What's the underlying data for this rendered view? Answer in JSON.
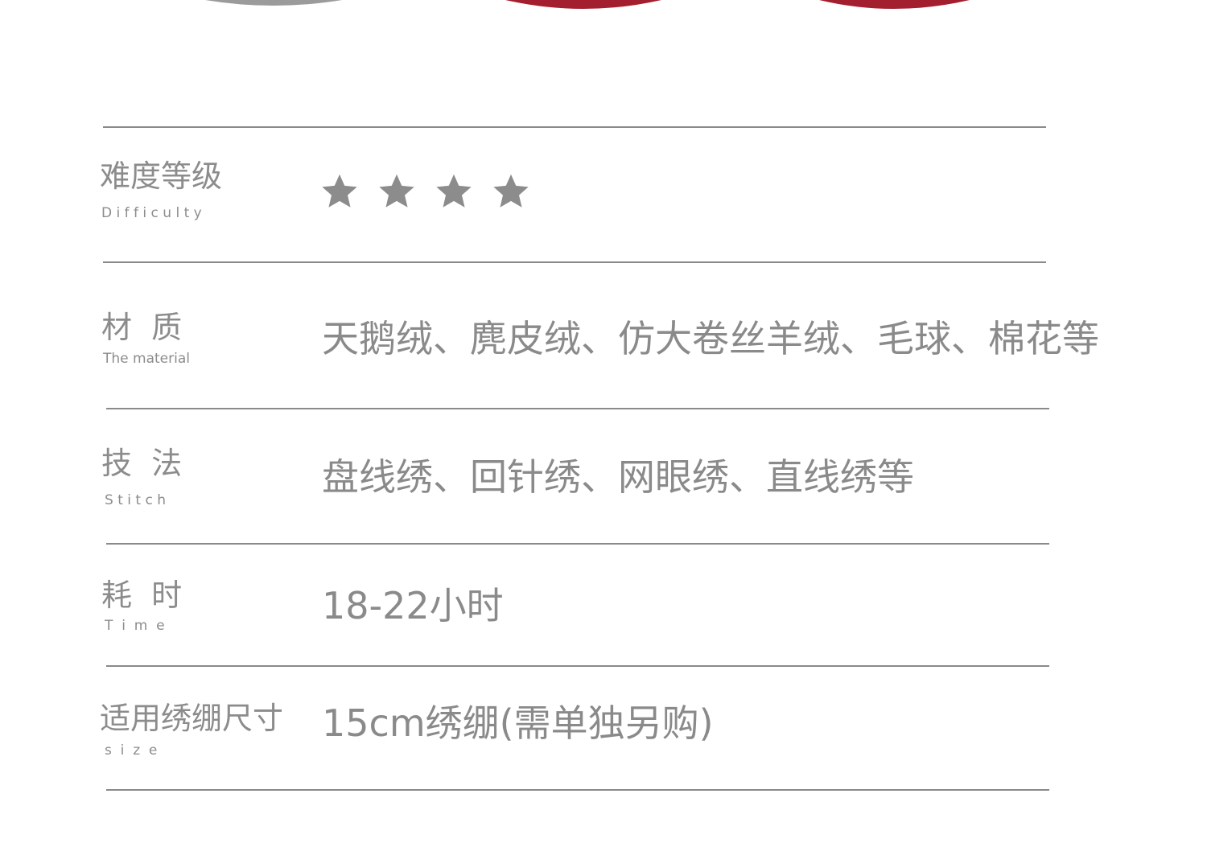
{
  "colors": {
    "background": "#ffffff",
    "text": "#8a8a8a",
    "divider": "#8a8a8a",
    "star": "#8c8c8c",
    "accent_red": "#a31e2e"
  },
  "specs": {
    "difficulty": {
      "label_cn": "难度等级",
      "label_en": "D i f f i c u l t y",
      "stars": 4,
      "star_icon": "star-icon"
    },
    "material": {
      "label_cn": "材  质",
      "label_en": "The material",
      "value": "天鹅绒、麂皮绒、仿大卷丝羊绒、毛球、棉花等"
    },
    "stitch": {
      "label_cn": "技  法",
      "label_en": "S t i t c h",
      "value": "盘线绣、回针绣、网眼绣、直线绣等"
    },
    "time": {
      "label_cn": "耗  时",
      "label_en": "T  i  m  e",
      "value": "18-22小时"
    },
    "size": {
      "label_cn": "适用绣绷尺寸",
      "label_en": "s  i  z  e",
      "value": "15cm绣绷(需单独另购)"
    }
  }
}
